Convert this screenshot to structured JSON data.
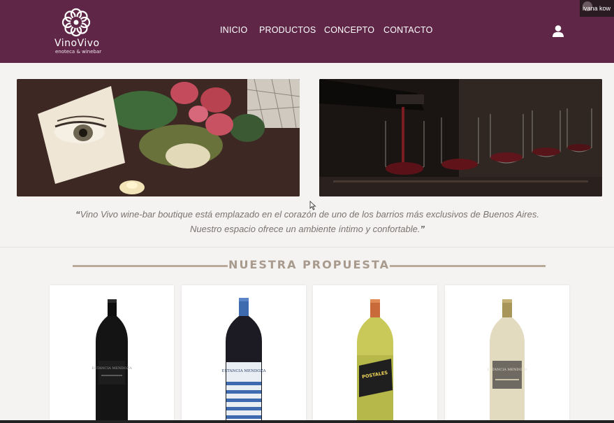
{
  "brand": {
    "name": "VinoVivo",
    "tagline": "enoteca & winebar",
    "color": "#5f2647"
  },
  "nav": {
    "items": [
      {
        "label": "INICIO"
      },
      {
        "label": "PRODUCTOS"
      },
      {
        "label": "CONCEPTO"
      },
      {
        "label": "CONTACTO"
      }
    ]
  },
  "participant": {
    "name": "ivana kow"
  },
  "quote": {
    "open_mark": "“",
    "line1": "Vino Vivo wine-bar boutique está emplazado en el corazón de uno de los barrios más exclusivos de Buenos Aires.",
    "line2": "Nuestro espacio ofrece un ambiente íntimo y confortable.",
    "close_mark": "”"
  },
  "section": {
    "title": "NUESTRA PROPUESTA"
  },
  "products": [
    {
      "label_text": "ESTANCIA MENDOZA",
      "style": "dark"
    },
    {
      "label_text": "ESTANCIA MENDOZA",
      "style": "blue-stripe"
    },
    {
      "label_text": "POSTALES",
      "style": "white-green"
    },
    {
      "label_text": "ESTANCIA MENDOZA",
      "style": "white-gold"
    }
  ]
}
